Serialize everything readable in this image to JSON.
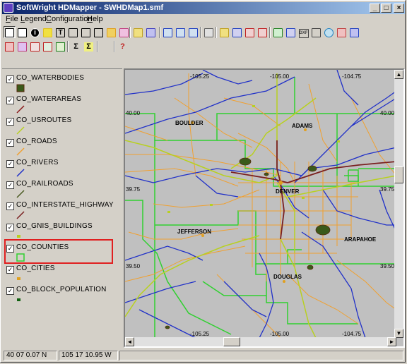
{
  "window": {
    "title": "SoftWright HDMapper - SWHDMap1.smf",
    "minimize": "_",
    "maximize": "□",
    "close": "×"
  },
  "menu": {
    "items": [
      "File",
      "Legend",
      "Configuration",
      "Help"
    ],
    "underlined": [
      "F",
      "L",
      "C",
      "H"
    ]
  },
  "toolbar": {
    "row1_icons": [
      "zoom-select-icon",
      "pan-hand-icon",
      "info-icon",
      "label-icon",
      "text-icon",
      "line-icon",
      "pointer-icon",
      "edit-point-icon",
      "open-folder-icon",
      "layer-edit-icon",
      "stack-icon",
      "stack2-icon",
      "zoom-in-icon",
      "zoom-out-icon",
      "zoom-extent-icon",
      "print-icon",
      "open-icon",
      "save-icon",
      "save-as-icon",
      "export-icon",
      "check-icon",
      "table-icon",
      "dxf-icon",
      "diamond-icon",
      "globe-icon",
      "image-icon",
      "grid-icon"
    ],
    "row1_glyphs": [
      "",
      "",
      "i",
      "",
      "T",
      "",
      "",
      "",
      "",
      "",
      "",
      "",
      "",
      "",
      "",
      "",
      "",
      "",
      "",
      "",
      "",
      "",
      "DXF",
      "",
      "",
      "",
      ""
    ],
    "row2_icons": [
      "layer-add-icon",
      "layer-color-icon",
      "points-icon",
      "grid-points-icon",
      "buildings-icon",
      "sigma-icon",
      "sigma-select-icon",
      "wrench-icon",
      "help-icon"
    ],
    "row2_glyphs": [
      "",
      "",
      "",
      "",
      "",
      "Σ",
      "Σ",
      "",
      "?"
    ]
  },
  "legend": {
    "layers": [
      {
        "name": "CO_WATERBODIES",
        "checked": "✓",
        "symbol": "waterbody-fill"
      },
      {
        "name": "CO_WATERAREAS",
        "checked": "✓",
        "symbol": "waterarea-line"
      },
      {
        "name": "CO_USROUTES",
        "checked": "✓",
        "symbol": "usroute-line"
      },
      {
        "name": "CO_ROADS",
        "checked": "✓",
        "symbol": "road-line"
      },
      {
        "name": "CO_RIVERS",
        "checked": "✓",
        "symbol": "river-line"
      },
      {
        "name": "CO_RAILROADS",
        "checked": "✓",
        "symbol": "railroad-line"
      },
      {
        "name": "CO_INTERSTATE_HIGHWAY",
        "checked": "✓",
        "symbol": "interstate-line"
      },
      {
        "name": "CO_GNIS_BUILDINGS",
        "checked": "✓",
        "symbol": "building-point"
      },
      {
        "name": "CO_COUNTIES",
        "checked": "✓",
        "symbol": "county-polygon"
      },
      {
        "name": "CO_CITIES",
        "checked": "✓",
        "symbol": "city-point"
      },
      {
        "name": "CO_BLOCK_POPULATION",
        "checked": "✓",
        "symbol": "block-point"
      }
    ],
    "colors": {
      "waterbody": "#3a5a1a",
      "waterarea": "#8b1a1a",
      "usroute": "#b8d020",
      "road": "#f0a030",
      "river": "#2030c8",
      "railroad": "#4a5a20",
      "interstate": "#7a2020",
      "building": "#b8d020",
      "county": "#30d030",
      "city": "#e0a020",
      "block": "#106010"
    }
  },
  "map": {
    "counties": [
      "BOULDER",
      "ADAMS",
      "DENVER",
      "JEFFERSON",
      "ARAPAHOE",
      "DOUGLAS"
    ],
    "longitudes_top": [
      "-105.25",
      "-105.00",
      "-104.75"
    ],
    "longitudes_bottom": [
      "-105.25",
      "-105.00",
      "-104.75"
    ],
    "latitudes_left": [
      "40.00",
      "39.75",
      "39.50"
    ],
    "latitudes_right": [
      "40.00",
      "39.75",
      "39.50"
    ],
    "background": "#c0c0c0"
  },
  "status": {
    "latitude": "40 07 0.07 N",
    "longitude": "105 17 10.95 W"
  }
}
